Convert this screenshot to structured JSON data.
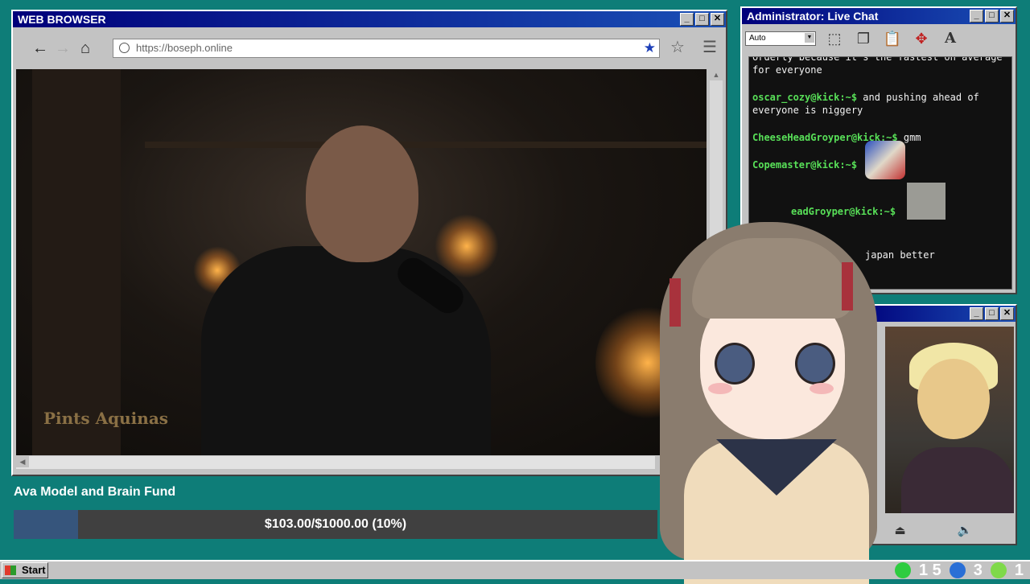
{
  "browser": {
    "title": "WEB BROWSER",
    "url": "https://boseph.online",
    "video_watermark": "Pints Aquinas"
  },
  "fund": {
    "title": "Ava Model and Brain Fund",
    "progress_text": "$103.00/$1000.00 (10%)",
    "progress": 0.1
  },
  "chat": {
    "title": "Administrator: Live Chat",
    "select_value": "Auto",
    "messages": [
      {
        "user": "",
        "text": "orderly because it's the fastest on average for everyone"
      },
      {
        "user": "oscar_cozy@kick:~$",
        "text": "and pushing ahead of everyone is niggery"
      },
      {
        "user": "CheeseHeadGroyper@kick:~$",
        "text": "gmm"
      },
      {
        "user": "Copemaster@kick:~$",
        "text": ""
      },
      {
        "user": "eadGroyper@kick:~$",
        "text": ""
      },
      {
        "user": "",
        "text": "japan better"
      }
    ]
  },
  "taskbar": {
    "start_label": "Start",
    "tray_counts": [
      "1 5",
      "3",
      "1"
    ]
  },
  "colors": {
    "desktop": "#0e7d78",
    "chat_user": "#58e058",
    "progress_fill": "#36557c"
  }
}
